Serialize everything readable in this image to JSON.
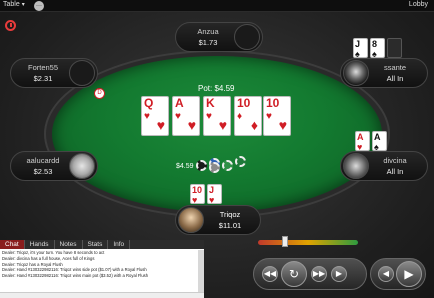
{
  "topbar": {
    "table_menu": "Table",
    "more": "···",
    "lobby": "Lobby"
  },
  "pot": {
    "label": "Pot: $4.59",
    "bet": "$4.59"
  },
  "dealer_button": "D",
  "players": {
    "anzua": {
      "name": "Anzua",
      "stack": "$1.73"
    },
    "forten": {
      "name": "Forten55",
      "stack": "$2.31"
    },
    "aalu": {
      "name": "aalucardd",
      "stack": "$2.53"
    },
    "ssante": {
      "name": "ssante",
      "stack": "All In"
    },
    "divcina": {
      "name": "divcina",
      "stack": "All In"
    },
    "triqoz": {
      "name": "Triqoz",
      "stack": "$11.01"
    }
  },
  "board": [
    {
      "rank": "Q",
      "suit": "♥",
      "color": "red"
    },
    {
      "rank": "A",
      "suit": "♥",
      "color": "red"
    },
    {
      "rank": "K",
      "suit": "♥",
      "color": "red"
    },
    {
      "rank": "10",
      "suit": "♦",
      "color": "red"
    },
    {
      "rank": "10",
      "suit": "♥",
      "color": "red"
    }
  ],
  "hole_cards": {
    "ssante": [
      {
        "rank": "J",
        "suit": "♠",
        "color": "black"
      },
      {
        "rank": "8",
        "suit": "♠",
        "color": "black"
      }
    ],
    "divcina": [
      {
        "rank": "A",
        "suit": "♥",
        "color": "red"
      },
      {
        "rank": "A",
        "suit": "♠",
        "color": "black"
      }
    ],
    "triqoz": [
      {
        "rank": "10",
        "suit": "♥",
        "color": "red"
      },
      {
        "rank": "J",
        "suit": "♥",
        "color": "red"
      }
    ]
  },
  "chat": {
    "tabs": [
      "Chat",
      "Hands",
      "Notes",
      "Stats",
      "Info"
    ],
    "lines": [
      "Dealer: Triqoz, it's your turn. You have 8 seconds to act",
      "Dealer: divcina has a full house, Aces full of Kings",
      "Dealer: Triqoz has a Royal Flush",
      "Dealer: Hand #130322982116: Triqoz wins side pot ($1.07) with a Royal Flush",
      "Dealer: Hand #130322982116: Triqoz wins main pot ($3.52) with a Royal Flush"
    ]
  },
  "actions": {
    "prev": "◀◀",
    "replay": "↻",
    "next": "▶▶",
    "back": "◀",
    "forward": "▶"
  },
  "colors": {
    "felt": "#137a30",
    "red_suit": "#d01d25",
    "accent": "#8a1d1d"
  }
}
